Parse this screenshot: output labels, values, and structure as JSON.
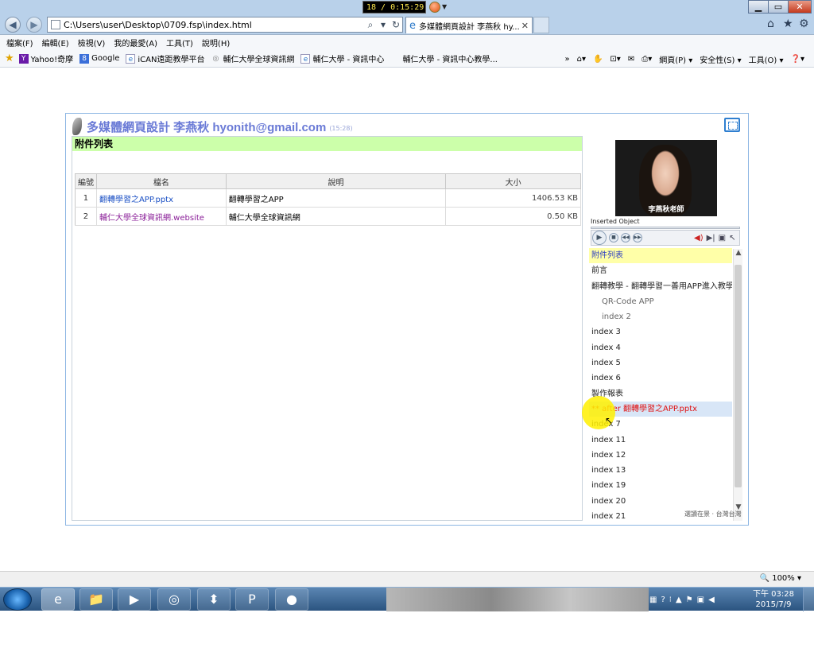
{
  "browser": {
    "address_url": "C:\\Users\\user\\Desktop\\0709.fsp\\index.html",
    "tab_title": "多媒體網頁設計 李燕秋 hy...",
    "recorder_counter": "18 / 0:15:29"
  },
  "menu": [
    "檔案(F)",
    "編輯(E)",
    "檢視(V)",
    "我的最愛(A)",
    "工具(T)",
    "說明(H)"
  ],
  "favorites": [
    {
      "label": "Yahoo!奇摩",
      "icon_text": "Y",
      "color": "#6a1ba8"
    },
    {
      "label": "Google",
      "icon_text": "8",
      "color": "#3b6fd9"
    },
    {
      "label": "iCAN遠距教學平台",
      "icon_text": "e",
      "color": "#2a78c9"
    },
    {
      "label": "輔仁大學全球資訊網",
      "icon_text": "◎",
      "color": "#888888"
    },
    {
      "label": "輔仁大學 - 資訊中心",
      "icon_text": "e",
      "color": "#2a78c9"
    },
    {
      "label": "輔仁大學 - 資訊中心教學...",
      "icon_text": "",
      "color": "#ffffff"
    }
  ],
  "favtools": [
    "網頁(P) ▾",
    "安全性(S) ▾",
    "工具(O) ▾"
  ],
  "page": {
    "title": "多媒體網頁設計 李燕秋 hyonith@gmail.com",
    "time": "(15:28)",
    "section_title": "附件列表",
    "columns": [
      "編號",
      "檔名",
      "說明",
      "大小"
    ],
    "attachments": [
      {
        "no": "1",
        "file": "翻轉學習之APP.pptx",
        "desc": "翻轉學習之APP",
        "size": "1406.53 KB"
      },
      {
        "no": "2",
        "file": "輔仁大學全球資訊網.website",
        "desc": "輔仁大學全球資訊網",
        "size": "0.50 KB"
      }
    ]
  },
  "video": {
    "caption": "李燕秋老師",
    "inserted_label": "Inserted Object"
  },
  "toc": [
    {
      "label": "附件列表",
      "kind": "cur"
    },
    {
      "label": "前言",
      "kind": ""
    },
    {
      "label": "翻轉教學 - 翻轉學習一善用APP進入教學",
      "kind": ""
    },
    {
      "label": "QR-Code APP",
      "kind": "sub"
    },
    {
      "label": "index 2",
      "kind": "sub"
    },
    {
      "label": "index 3",
      "kind": ""
    },
    {
      "label": "index 4",
      "kind": ""
    },
    {
      "label": "index 5",
      "kind": ""
    },
    {
      "label": "index 6",
      "kind": ""
    },
    {
      "label": "製作報表",
      "kind": ""
    },
    {
      "label": "** after 翻轉學習之APP.pptx",
      "kind": "hl"
    },
    {
      "label": "index 7",
      "kind": ""
    },
    {
      "label": "index 11",
      "kind": ""
    },
    {
      "label": "index 12",
      "kind": ""
    },
    {
      "label": "index 13",
      "kind": ""
    },
    {
      "label": "index 19",
      "kind": ""
    },
    {
      "label": "index 20",
      "kind": ""
    },
    {
      "label": "index 21",
      "kind": ""
    }
  ],
  "toc_footer": "選讀在景 · 台灣台灣",
  "status": {
    "zoom": "🔍 100%  ▾"
  },
  "clock": {
    "time": "下午 03:28",
    "date": "2015/7/9"
  }
}
